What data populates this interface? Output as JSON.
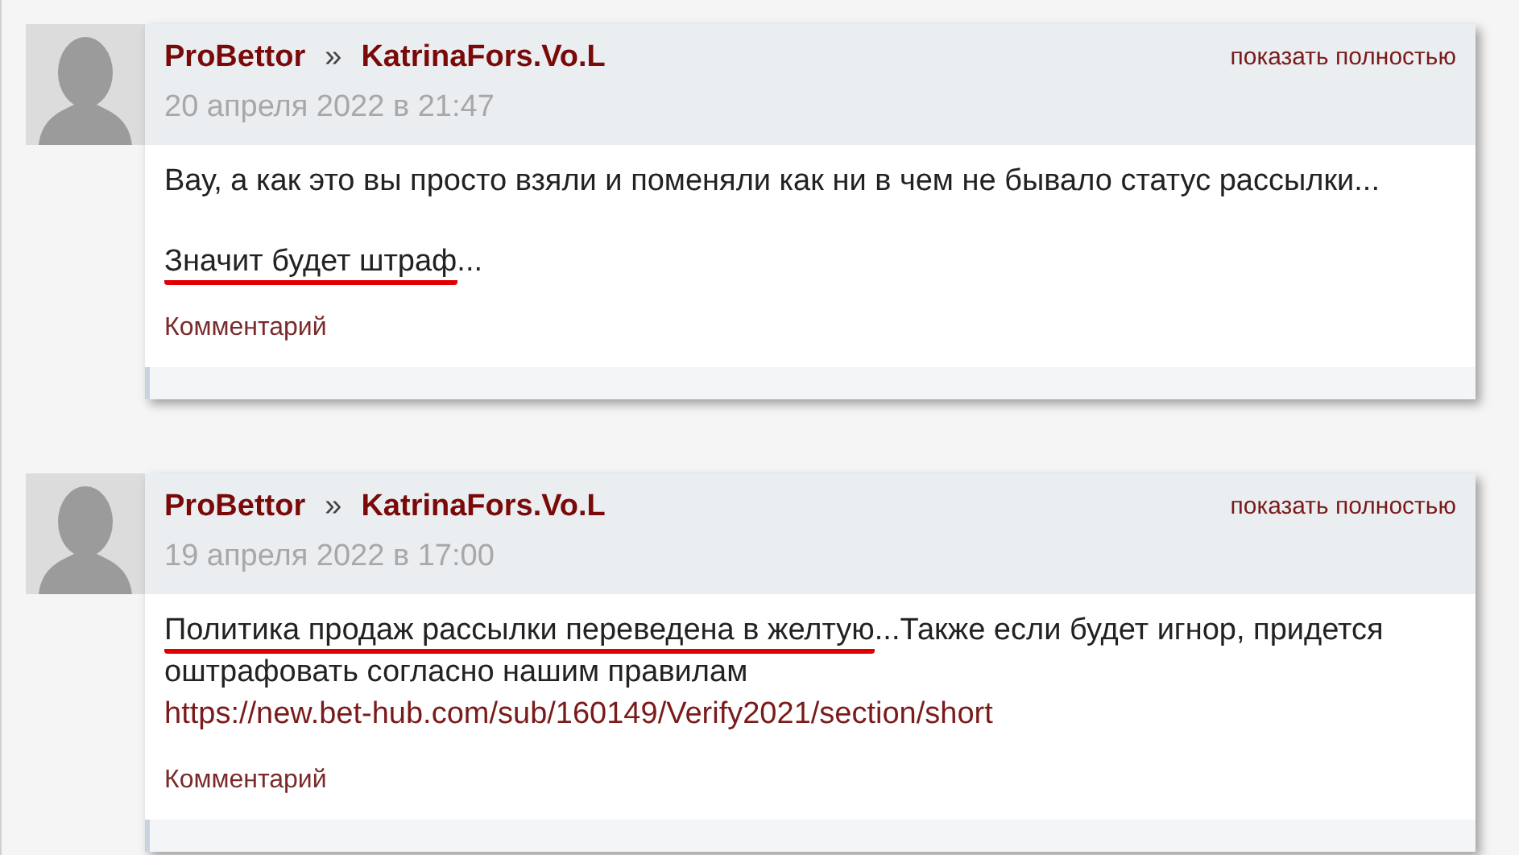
{
  "comments": [
    {
      "author": "ProBettor",
      "separator": "»",
      "recipient": "KatrinaFors.Vo.L",
      "date": "20 апреля 2022 в 21:47",
      "expand_link": "показать полностью",
      "paragraphs": [
        [
          {
            "kind": "plain",
            "text": "Вау, а как это вы просто взяли и поменяли как ни в чем не бывало статус рассылки..."
          }
        ],
        [
          {
            "kind": "underlined",
            "text": "Значит будет штраф"
          },
          {
            "kind": "plain",
            "text": "..."
          }
        ]
      ],
      "comment_link": "Комментарий"
    },
    {
      "author": "ProBettor",
      "separator": "»",
      "recipient": "KatrinaFors.Vo.L",
      "date": "19 апреля 2022 в 17:00",
      "expand_link": "показать полностью",
      "paragraphs": [
        [
          {
            "kind": "underlined",
            "text": "Политика продаж рассылки переведена в желтую"
          },
          {
            "kind": "plain",
            "text": "...Также если будет игнор, придется оштрафовать согласно нашим правилам "
          },
          {
            "kind": "link",
            "text": "https://new.bet-hub.com/sub/160149/Verify2021/section/short"
          }
        ]
      ],
      "comment_link": "Комментарий"
    }
  ]
}
